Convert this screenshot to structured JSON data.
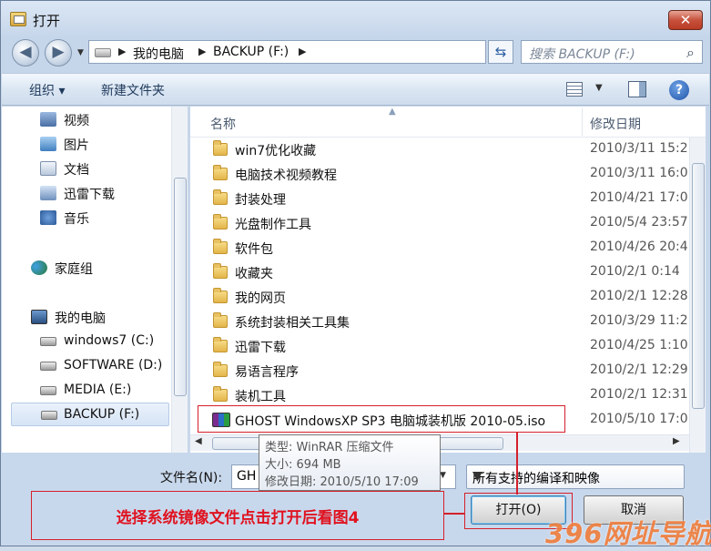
{
  "window": {
    "title": "打开",
    "close_glyph": "✕"
  },
  "nav": {
    "back_glyph": "◀",
    "forward_glyph": "▶",
    "refresh_glyph": "⇆"
  },
  "address": {
    "segments": [
      "我的电脑",
      "BACKUP (F:)"
    ],
    "separator": "▶"
  },
  "search": {
    "placeholder": "搜索 BACKUP (F:)",
    "icon": "search-icon"
  },
  "toolbar": {
    "organize": "组织 ▾",
    "new_folder": "新建文件夹",
    "help_glyph": "?"
  },
  "sidebar": {
    "items": [
      {
        "label": "视频",
        "icon": "video-library-icon"
      },
      {
        "label": "图片",
        "icon": "picture-library-icon"
      },
      {
        "label": "文档",
        "icon": "document-library-icon"
      },
      {
        "label": "迅雷下载",
        "icon": "download-library-icon"
      },
      {
        "label": "音乐",
        "icon": "music-library-icon"
      },
      {
        "label": "家庭组",
        "icon": "homegroup-icon"
      },
      {
        "label": "我的电脑",
        "icon": "computer-icon"
      },
      {
        "label": "windows7 (C:)",
        "icon": "drive-icon"
      },
      {
        "label": "SOFTWARE (D:)",
        "icon": "drive-icon"
      },
      {
        "label": "MEDIA (E:)",
        "icon": "drive-icon"
      },
      {
        "label": "BACKUP (F:)",
        "icon": "drive-icon",
        "selected": true
      }
    ]
  },
  "filelist": {
    "columns": {
      "name": "名称",
      "modified": "修改日期"
    },
    "rows": [
      {
        "name": "win7优化收藏",
        "modified": "2010/3/11 15:2"
      },
      {
        "name": "电脑技术视频教程",
        "modified": "2010/3/11 16:0"
      },
      {
        "name": "封装处理",
        "modified": "2010/4/21 17:0"
      },
      {
        "name": "光盘制作工具",
        "modified": "2010/5/4 23:57"
      },
      {
        "name": "软件包",
        "modified": "2010/4/26 20:4"
      },
      {
        "name": "收藏夹",
        "modified": "2010/2/1 0:14"
      },
      {
        "name": "我的网页",
        "modified": "2010/2/1 12:28"
      },
      {
        "name": "系统封装相关工具集",
        "modified": "2010/3/29 11:2"
      },
      {
        "name": "迅雷下载",
        "modified": "2010/4/25 1:10"
      },
      {
        "name": "易语言程序",
        "modified": "2010/2/1 12:29"
      },
      {
        "name": "装机工具",
        "modified": "2010/2/1 12:31"
      },
      {
        "name": "GHOST WindowsXP SP3 电脑城装机版 2010-05.iso",
        "modified": "2010/5/10 17:0",
        "icon": "winrar-archive-icon"
      }
    ]
  },
  "tooltip": {
    "type": "类型: WinRAR 压缩文件",
    "size": "大小: 694 MB",
    "modified": "修改日期: 2010/5/10 17:09"
  },
  "footer": {
    "filename_label": "文件名(N):",
    "filename_value": "GH",
    "filetype_value": "所有支持的编译和映像",
    "open_button": "打开(O)",
    "cancel_button": "取消"
  },
  "annotation": {
    "callout": "选择系统镜像文件点击打开后看图4"
  },
  "watermark": {
    "text": "396网址导航"
  },
  "colors": {
    "annotation_red": "#d5202b",
    "watermark_orange": "#f07f3e"
  }
}
